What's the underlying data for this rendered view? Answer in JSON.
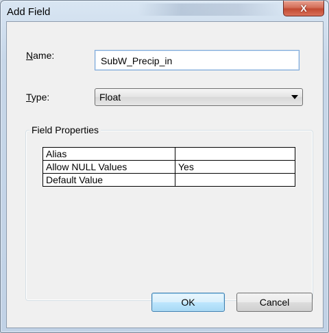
{
  "window": {
    "title": "Add Field",
    "close_glyph": "X"
  },
  "form": {
    "name_label_accel": "N",
    "name_label_rest": "ame:",
    "name_value": "SubW_Precip_in",
    "type_label_accel": "T",
    "type_label_rest": "ype:",
    "type_value": "Float"
  },
  "field_properties": {
    "title": "Field Properties",
    "rows": [
      {
        "key": "Alias",
        "value": ""
      },
      {
        "key": "Allow NULL Values",
        "value": "Yes"
      },
      {
        "key": "Default Value",
        "value": ""
      }
    ]
  },
  "buttons": {
    "ok": "OK",
    "cancel": "Cancel"
  },
  "colors": {
    "close_button": "#c24a33",
    "dialog_background": "#f0f0f0",
    "ok_focus_border": "#3c7fb1"
  }
}
